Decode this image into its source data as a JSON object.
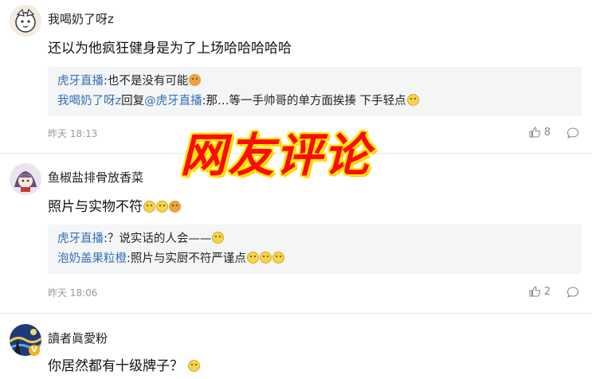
{
  "comments": [
    {
      "username": "我喝奶了呀z",
      "content": "还以为他疯狂健身是为了上场哈哈哈哈哈",
      "replies": [
        {
          "author": "虎牙直播",
          "text": ":也不是没有可能"
        },
        {
          "author": "我喝奶了呀z",
          "mid": "回复",
          "target": "@虎牙直播",
          "text": ":那…等一手帅哥的单方面挨揍 下手轻点"
        }
      ],
      "time": "昨天 18:13",
      "likes": "8"
    },
    {
      "username": "鱼椒盐排骨放香菜",
      "content": "照片与实物不符",
      "replies": [
        {
          "author": "虎牙直播",
          "text": ":？说实话的人会——"
        },
        {
          "author": "泡奶盖果粒橙",
          "text": ":照片与实厨不符严谨点"
        }
      ],
      "time": "昨天 18:06",
      "likes": "2"
    },
    {
      "username": "讀者眞愛粉",
      "content": "你居然都有十级牌子？",
      "badge": "V"
    }
  ],
  "overlay_text": "网友评论",
  "icons": [
    "thumb-up-icon",
    "comment-bubble-icon",
    "emoji-icon",
    "avatar-icon"
  ],
  "colors": {
    "link": "#3470b5",
    "overlay": "#ff0a0a",
    "overlay_outline": "#ffe800",
    "reply_bg": "#f4f5f7"
  }
}
